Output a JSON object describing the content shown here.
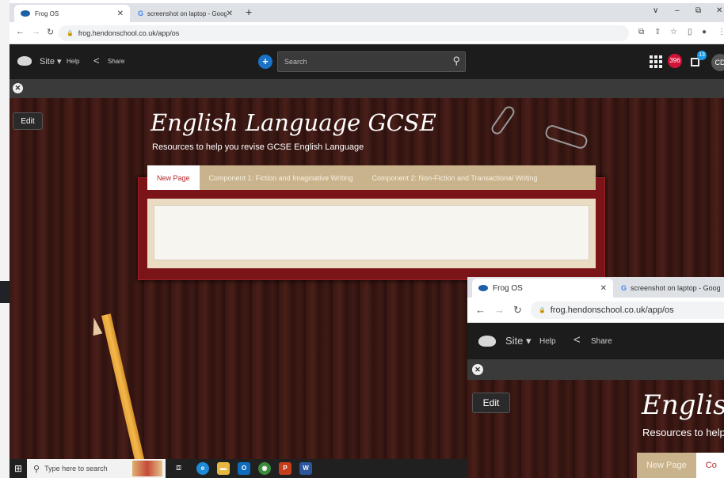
{
  "main": {
    "tabs": [
      {
        "title": "Frog OS"
      },
      {
        "title": "screenshot on laptop - Google"
      }
    ],
    "new_tab_symbol": "+",
    "window_controls": [
      "∨",
      "–",
      "⧉",
      "✕"
    ],
    "address": "frog.hendonschool.co.uk/app/os",
    "frog": {
      "site_label": "Site ▾",
      "help_label": "Help",
      "share_label": "Share",
      "search_placeholder": "Search",
      "notifications_count": "396",
      "messages_count": "13",
      "user_initials": "CD"
    },
    "edit_label": "Edit",
    "page": {
      "title": "English Language GCSE",
      "subtitle": "Resources to help you revise GCSE English Language",
      "tabs": [
        "New Page",
        "Component 1: Fiction and Imaginative Writing",
        "Component 2: Non-Fiction and Transactional Writing"
      ]
    }
  },
  "taskbar": {
    "search_placeholder": "Type here to search"
  },
  "second": {
    "tabs": [
      {
        "title": "Frog OS"
      },
      {
        "title": "screenshot on laptop - Goog"
      }
    ],
    "address": "frog.hendonschool.co.uk/app/os",
    "site_label": "Site ▾",
    "help_label": "Help",
    "share_label": "Share",
    "edit_label": "Edit",
    "title": "English L",
    "subtitle": "Resources to help",
    "tabs_content": [
      "New Page",
      "Co"
    ]
  },
  "colors": {
    "accent_blue": "#1a73c8",
    "badge_red": "#d3123a",
    "active_tab_text": "#b4262a"
  }
}
